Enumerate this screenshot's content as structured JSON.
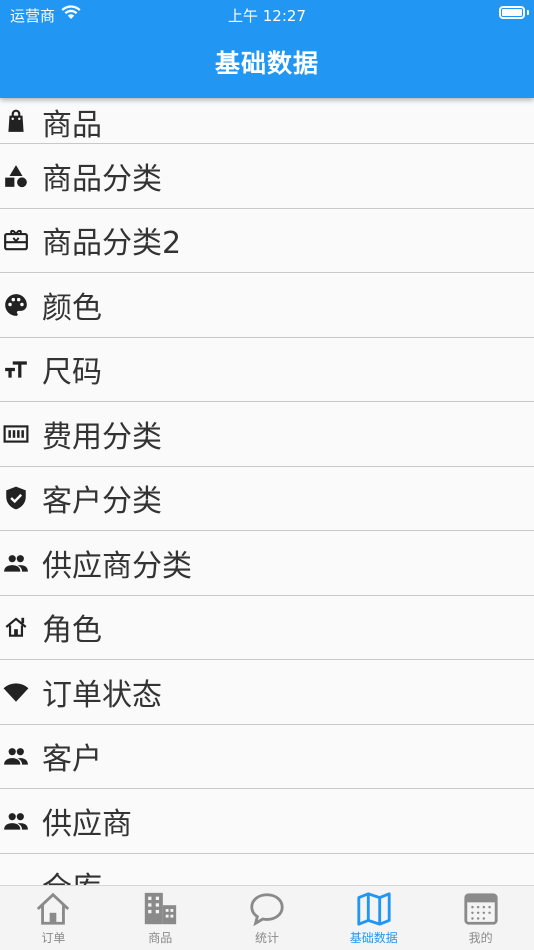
{
  "status_bar": {
    "carrier": "运营商",
    "time": "上午 12:27"
  },
  "app_bar": {
    "title": "基础数据"
  },
  "colors": {
    "primary": "#2196f3",
    "icon": "#222222",
    "tab_inactive": "#8a8a8a"
  },
  "list": {
    "items": [
      {
        "label": "商品",
        "icon": "shopping-bag-icon"
      },
      {
        "label": "商品分类",
        "icon": "category-shapes-icon"
      },
      {
        "label": "商品分类2",
        "icon": "card-giftcard-icon"
      },
      {
        "label": "颜色",
        "icon": "palette-icon"
      },
      {
        "label": "尺码",
        "icon": "text-size-icon"
      },
      {
        "label": "费用分类",
        "icon": "barcode-meter-icon"
      },
      {
        "label": "客户分类",
        "icon": "verified-shield-icon"
      },
      {
        "label": "供应商分类",
        "icon": "people-icon"
      },
      {
        "label": "角色",
        "icon": "house-roof-icon"
      },
      {
        "label": "订单状态",
        "icon": "wifi-signal-icon"
      },
      {
        "label": "客户",
        "icon": "people-icon"
      },
      {
        "label": "供应商",
        "icon": "people-icon"
      },
      {
        "label": "仓库",
        "icon": "partial-icon"
      }
    ]
  },
  "tab_bar": {
    "tabs": [
      {
        "label": "订单",
        "icon": "home-icon",
        "active": false
      },
      {
        "label": "商品",
        "icon": "buildings-icon",
        "active": false
      },
      {
        "label": "统计",
        "icon": "chat-bubble-icon",
        "active": false
      },
      {
        "label": "基础数据",
        "icon": "map-icon",
        "active": true
      },
      {
        "label": "我的",
        "icon": "calendar-icon",
        "active": false
      }
    ]
  }
}
